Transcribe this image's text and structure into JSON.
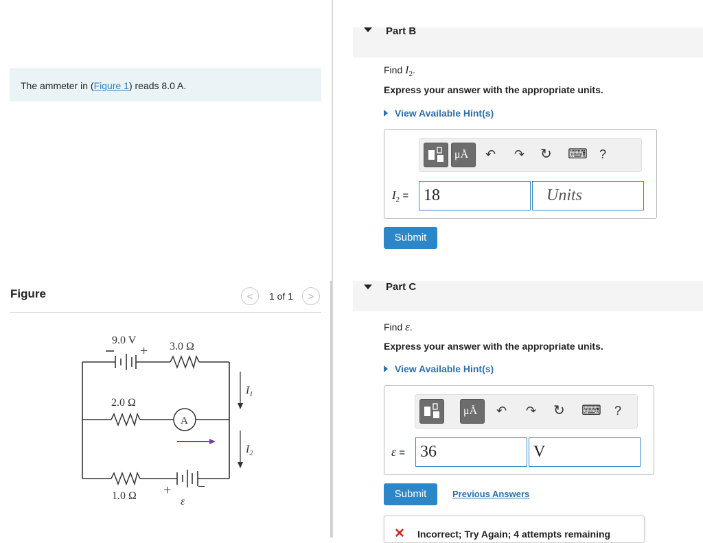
{
  "problem": {
    "prompt_prefix": "The ammeter in (",
    "figure_link": "Figure 1",
    "prompt_suffix": ") reads 8.0 A."
  },
  "figure": {
    "title": "Figure",
    "pager": "1 of 1",
    "prev_symbol": "<",
    "next_symbol": ">",
    "labels": {
      "battery_top": "9.0 V",
      "battery_top_sign": "+",
      "resistor_top": "3.0 Ω",
      "resistor_mid": "2.0 Ω",
      "resistor_bot": "1.0 Ω",
      "ammeter": "A",
      "current1_main": "I",
      "current1_sub": "1",
      "current2_main": "I",
      "current2_sub": "2",
      "emf": "ε",
      "emf_plus": "+",
      "emf_minus": "−"
    }
  },
  "partB": {
    "title": "Part B",
    "find_prefix": "Find ",
    "find_var": "I",
    "find_sub": "2",
    "find_suffix": ".",
    "express": "Express your answer with the appropriate units.",
    "hint": "View Available Hint(s)",
    "var_label": "I",
    "var_sub": "2",
    "equals": "=",
    "value": "18",
    "units_placeholder": "Units",
    "submit": "Submit"
  },
  "partC": {
    "title": "Part C",
    "find_prefix": "Find ",
    "find_var": "ε",
    "find_suffix": ".",
    "express": "Express your answer with the appropriate units.",
    "hint": "View Available Hint(s)",
    "var_label": "ε",
    "equals": "=",
    "value": "36",
    "units_value": "V",
    "submit": "Submit",
    "previous_answers": "Previous Answers",
    "feedback_icon": "✕",
    "feedback": "Incorrect; Try Again; 4 attempts remaining"
  },
  "toolbar": {
    "units_btn": "μÅ",
    "undo": "↶",
    "redo": "↷",
    "reset": "↻",
    "keyboard": "⌨",
    "help": "?"
  },
  "colors": {
    "accent": "#2d86c7",
    "link": "#2f6faa",
    "error": "#d0271d",
    "arrow": "#7d3f98",
    "prompt_bg": "#eaf4f7"
  }
}
